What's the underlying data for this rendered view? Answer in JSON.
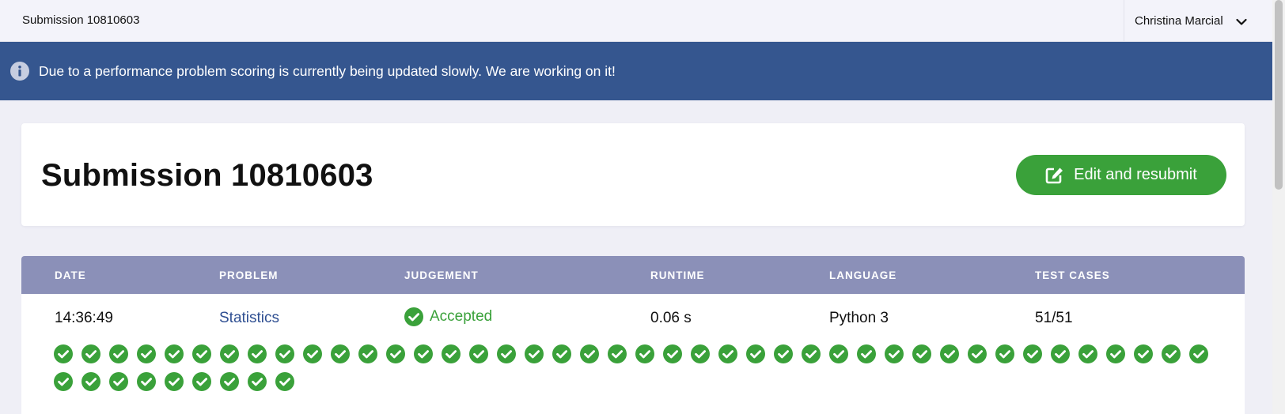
{
  "topbar": {
    "title": "Submission 10810603",
    "user_name": "Christina Marcial"
  },
  "banner": {
    "icon": "info-icon",
    "text": "Due to a performance problem scoring is currently being updated slowly. We are working on it!"
  },
  "header": {
    "title": "Submission 10810603",
    "resubmit_label": "Edit and resubmit"
  },
  "table": {
    "headers": [
      "DATE",
      "PROBLEM",
      "JUDGEMENT",
      "RUNTIME",
      "LANGUAGE",
      "TEST CASES"
    ],
    "row": {
      "date": "14:36:49",
      "problem": "Statistics",
      "judgement": "Accepted",
      "runtime": "0.06 s",
      "language": "Python 3",
      "test_cases": "51/51"
    },
    "test_results": {
      "passed": 51,
      "total": 51
    }
  },
  "colors": {
    "banner": "#35568f",
    "accent_green": "#3aa13a",
    "table_header": "#8b90b8",
    "link": "#2f4f92"
  }
}
